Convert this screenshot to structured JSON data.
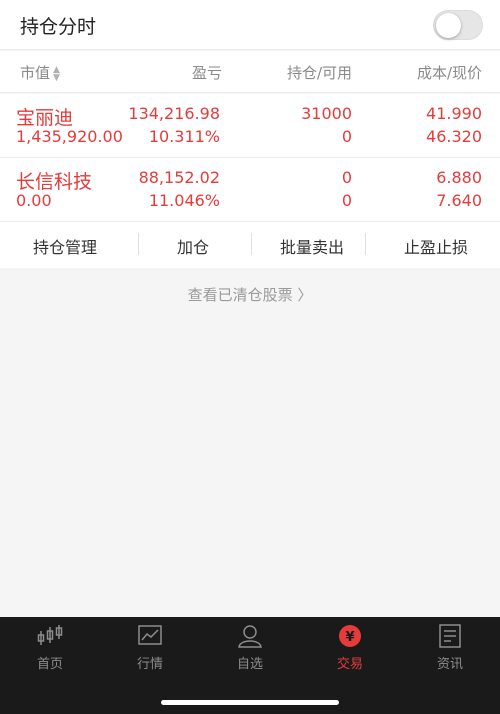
{
  "header": {
    "title": "持仓分时",
    "toggle_on": false
  },
  "columns": {
    "market_value": "市值",
    "profit_loss": "盈亏",
    "position": "持仓/可用",
    "cost_price": "成本/现价"
  },
  "holdings": [
    {
      "name": "宝丽迪",
      "market_value": "1,435,920.00",
      "profit_loss": "134,216.98",
      "profit_loss_pct": "10.311%",
      "position": "31000",
      "available": "0",
      "cost": "41.990",
      "price": "46.320"
    },
    {
      "name": "长信科技",
      "market_value": "0.00",
      "profit_loss": "88,152.02",
      "profit_loss_pct": "11.046%",
      "position": "0",
      "available": "0",
      "cost": "6.880",
      "price": "7.640"
    }
  ],
  "actions": {
    "manage": "持仓管理",
    "add": "加仓",
    "batch_sell": "批量卖出",
    "stop": "止盈止损"
  },
  "cleared_link": "查看已清仓股票 〉",
  "tabs": [
    {
      "label": "首页",
      "icon": "candlestick-icon"
    },
    {
      "label": "行情",
      "icon": "chart-icon"
    },
    {
      "label": "自选",
      "icon": "person-icon"
    },
    {
      "label": "交易",
      "icon": "yen-icon"
    },
    {
      "label": "资讯",
      "icon": "news-icon"
    }
  ],
  "colors": {
    "accent": "#e63b3b",
    "tabbar": "#1a1a1a",
    "background": "#f5f5f5"
  }
}
